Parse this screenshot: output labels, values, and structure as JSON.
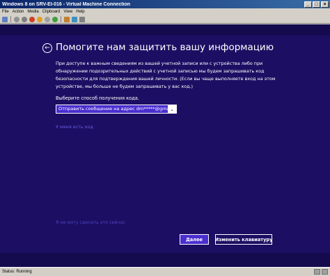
{
  "window": {
    "title": "Windows 8 on SRV-EI-016 - Virtual Machine Connection",
    "min_label": "_",
    "max_label": "□",
    "close_label": "×"
  },
  "menu": [
    "File",
    "Action",
    "Media",
    "Clipboard",
    "View",
    "Help"
  ],
  "guest": {
    "back_glyph": "←",
    "heading": "Помогите нам защитить вашу информацию",
    "description_lines": [
      "При доступе к важным сведениям из вашей учетной записи или с устройства либо при",
      "обнаружении подозрительных действий с учетной записью мы будем запрашивать код",
      "безопасности для подтверждения вашей личности. (Если вы чаще выполняете вход на этом",
      "устройстве, мы больше не будем запрашивать у вас код.)"
    ],
    "choose_label": "Выберите способ получения кода.",
    "select_value": "Отправить сообщение на адрес dm*****@gmail.c",
    "select_arrow": "⌄",
    "have_code_link": "У меня есть код",
    "cant_now_link": "Я не могу сделать это сейчас",
    "next_button": "Далее",
    "keyboard_button": "Изменить клавиатуру"
  },
  "status": {
    "text": "Status: Running"
  },
  "colors": {
    "screen_bg": "#1c0f63",
    "accent": "#4a2ed0",
    "link": "#6a5ae0"
  }
}
